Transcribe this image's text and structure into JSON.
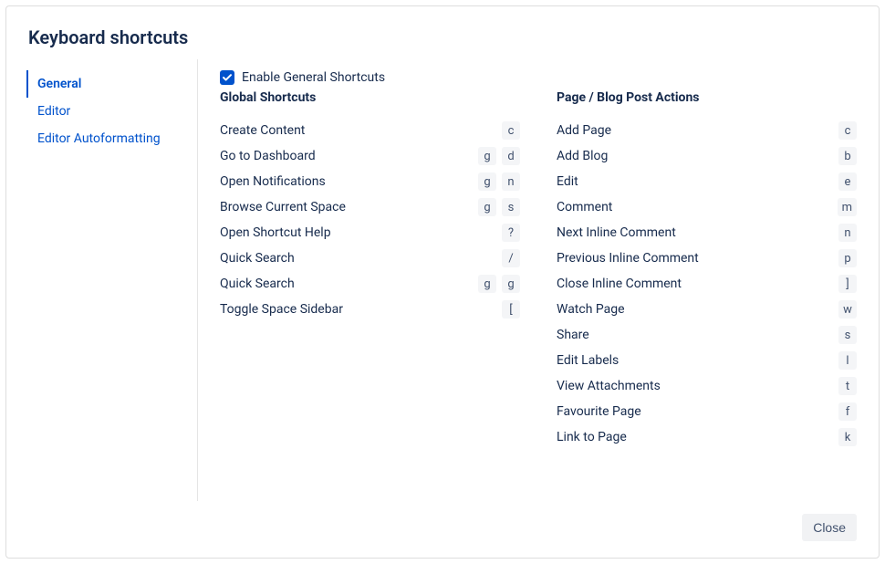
{
  "title": "Keyboard shortcuts",
  "sidebar": {
    "items": [
      {
        "label": "General",
        "active": true
      },
      {
        "label": "Editor",
        "active": false
      },
      {
        "label": "Editor Autoformatting",
        "active": false
      }
    ]
  },
  "enable": {
    "checked": true,
    "label": "Enable General Shortcuts"
  },
  "columns": [
    {
      "title": "Global Shortcuts",
      "shortcuts": [
        {
          "label": "Create Content",
          "keys": [
            "c"
          ]
        },
        {
          "label": "Go to Dashboard",
          "keys": [
            "g",
            "d"
          ]
        },
        {
          "label": "Open Notifications",
          "keys": [
            "g",
            "n"
          ]
        },
        {
          "label": "Browse Current Space",
          "keys": [
            "g",
            "s"
          ]
        },
        {
          "label": "Open Shortcut Help",
          "keys": [
            "?"
          ]
        },
        {
          "label": "Quick Search",
          "keys": [
            "/"
          ]
        },
        {
          "label": "Quick Search",
          "keys": [
            "g",
            "g"
          ]
        },
        {
          "label": "Toggle Space Sidebar",
          "keys": [
            "["
          ]
        }
      ]
    },
    {
      "title": "Page / Blog Post Actions",
      "shortcuts": [
        {
          "label": "Add Page",
          "keys": [
            "c"
          ]
        },
        {
          "label": "Add Blog",
          "keys": [
            "b"
          ]
        },
        {
          "label": "Edit",
          "keys": [
            "e"
          ]
        },
        {
          "label": "Comment",
          "keys": [
            "m"
          ]
        },
        {
          "label": "Next Inline Comment",
          "keys": [
            "n"
          ]
        },
        {
          "label": "Previous Inline Comment",
          "keys": [
            "p"
          ]
        },
        {
          "label": "Close Inline Comment",
          "keys": [
            "]"
          ]
        },
        {
          "label": "Watch Page",
          "keys": [
            "w"
          ]
        },
        {
          "label": "Share",
          "keys": [
            "s"
          ]
        },
        {
          "label": "Edit Labels",
          "keys": [
            "l"
          ]
        },
        {
          "label": "View Attachments",
          "keys": [
            "t"
          ]
        },
        {
          "label": "Favourite Page",
          "keys": [
            "f"
          ]
        },
        {
          "label": "Link to Page",
          "keys": [
            "k"
          ]
        }
      ]
    }
  ],
  "footer": {
    "close_label": "Close"
  }
}
